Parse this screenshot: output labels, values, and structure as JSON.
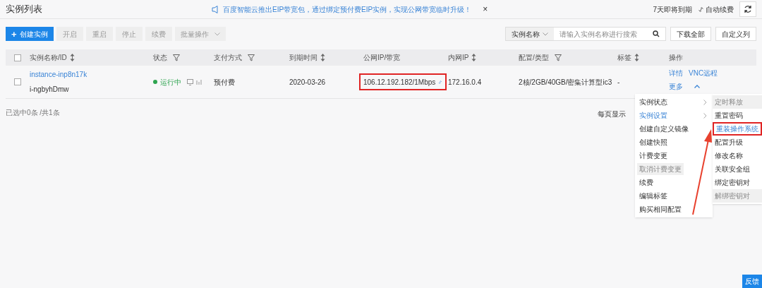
{
  "page_title": "实例列表",
  "notice": {
    "text": "百度智能云推出EIP带宽包，通过绑定预付费EIP实例，实现公网带宽临时升级！",
    "close": "×"
  },
  "header_links": {
    "expiring": "7天即将到期",
    "auto_renew": "自动续费"
  },
  "toolbar": {
    "buttons": [
      {
        "label": "创建实例",
        "icon": "+",
        "kind": "primary",
        "disabled": false
      },
      {
        "label": "开启",
        "kind": "plain",
        "disabled": true
      },
      {
        "label": "重启",
        "kind": "plain",
        "disabled": true
      },
      {
        "label": "停止",
        "kind": "plain",
        "disabled": true
      },
      {
        "label": "续费",
        "kind": "plain",
        "disabled": true
      },
      {
        "label": "批量操作",
        "kind": "dropdown",
        "disabled": true
      }
    ],
    "search": {
      "filter": "实例名称",
      "placeholder": "请输入实例名称进行搜索"
    },
    "right_buttons": [
      "下载全部",
      "自定义列"
    ]
  },
  "table": {
    "header_checked": false,
    "columns": [
      {
        "label": "实例名称/ID",
        "kind": "sort"
      },
      {
        "label": "状态",
        "kind": "filter"
      },
      {
        "label": "支付方式",
        "kind": "filter"
      },
      {
        "label": "到期时间",
        "kind": "sort"
      },
      {
        "label": "公网IP/带宽",
        "kind": "plain"
      },
      {
        "label": "内网IP",
        "kind": "sort"
      },
      {
        "label": "配置/类型",
        "kind": "filter"
      },
      {
        "label": "标签",
        "kind": "sort"
      },
      {
        "label": "操作",
        "kind": "plain"
      }
    ],
    "rows": [
      {
        "checked": false,
        "name": "instance-inp8n17k",
        "id": "i-ngbyhDmw",
        "status": "运行中",
        "color": "#2ea44f",
        "payment": "预付费",
        "expire": "2020-03-26",
        "public_ip": "106.12.192.182/1Mbps",
        "public_ip_highlighted": true,
        "private_ip": "172.16.0.4",
        "config": "2核/2GB/40GB/密集计算型ic3",
        "tag": "-",
        "actions": [
          "详情",
          "VNC远程"
        ],
        "more": "更多",
        "more_expanded": true
      }
    ]
  },
  "footer": {
    "selection": "已选中0条 /共1条",
    "page_size_label": "每页显示"
  },
  "menu": {
    "items": [
      {
        "label": "实例状态",
        "submenu": true,
        "selected": false,
        "disabled": false
      },
      {
        "label": "实例设置",
        "submenu": true,
        "selected": true,
        "disabled": false
      },
      {
        "label": "创建自定义镜像",
        "submenu": false,
        "selected": false,
        "disabled": false
      },
      {
        "label": "创建快照",
        "submenu": false,
        "selected": false,
        "disabled": false
      },
      {
        "label": "计费变更",
        "submenu": false,
        "selected": false,
        "disabled": false
      },
      {
        "label": "取消计费变更",
        "submenu": false,
        "selected": false,
        "disabled": true
      },
      {
        "label": "续费",
        "submenu": false,
        "selected": false,
        "disabled": false
      },
      {
        "label": "编辑标签",
        "submenu": false,
        "selected": false,
        "disabled": false
      },
      {
        "label": "购买相同配置",
        "submenu": false,
        "selected": false,
        "disabled": false
      }
    ],
    "submenu_items": [
      {
        "label": "定时释放",
        "selected": false,
        "disabled": true,
        "highlighted": false
      },
      {
        "label": "重置密码",
        "selected": false,
        "disabled": false,
        "highlighted": false
      },
      {
        "label": "重装操作系统",
        "selected": true,
        "disabled": false,
        "highlighted": true
      },
      {
        "label": "配置升级",
        "selected": false,
        "disabled": false,
        "highlighted": false
      },
      {
        "label": "修改名称",
        "selected": false,
        "disabled": false,
        "highlighted": false
      },
      {
        "label": "关联安全组",
        "selected": false,
        "disabled": false,
        "highlighted": false
      },
      {
        "label": "绑定密钥对",
        "selected": false,
        "disabled": false,
        "highlighted": false
      },
      {
        "label": "解绑密钥对",
        "selected": false,
        "disabled": true,
        "highlighted": false
      }
    ]
  },
  "feedback_button": "反馈"
}
